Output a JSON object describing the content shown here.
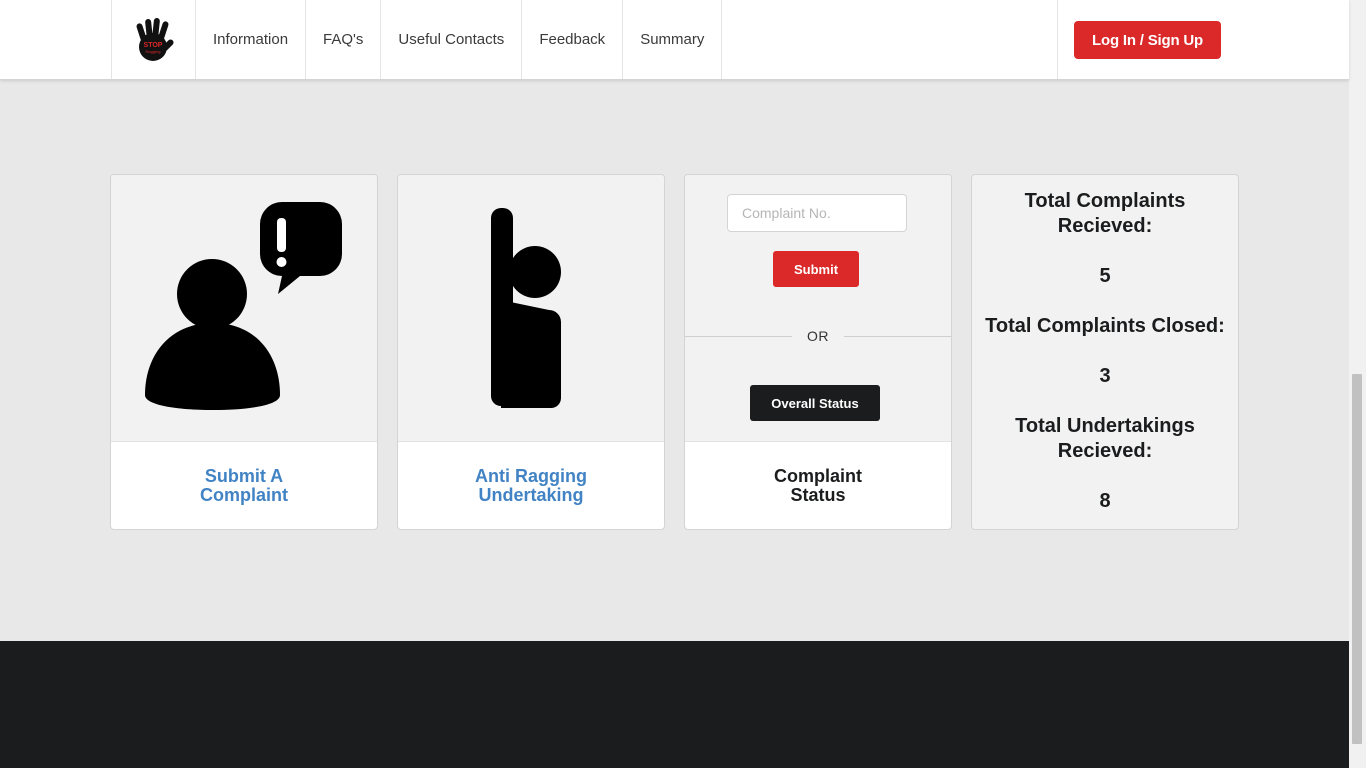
{
  "navbar": {
    "logo_text": "STOP Ragging",
    "items": [
      {
        "label": "Information"
      },
      {
        "label": "FAQ's"
      },
      {
        "label": "Useful Contacts"
      },
      {
        "label": "Feedback"
      },
      {
        "label": "Summary"
      }
    ],
    "login_label": "Log In / Sign Up"
  },
  "cards": {
    "submit_complaint": {
      "label_line1": "Submit A",
      "label_line2": "Complaint",
      "icon": "person-speech-exclamation-icon"
    },
    "anti_ragging": {
      "label_line1": "Anti Ragging",
      "label_line2": "Undertaking",
      "icon": "raised-hand-icon"
    },
    "status": {
      "input_placeholder": "Complaint No.",
      "submit_label": "Submit",
      "or_label": "OR",
      "overall_label": "Overall Status",
      "label_line1": "Complaint",
      "label_line2": "Status"
    },
    "stats": {
      "received_label": "Total Complaints Recieved:",
      "received_value": "5",
      "closed_label": "Total Complaints Closed:",
      "closed_value": "3",
      "undertakings_label": "Total Undertakings Recieved:",
      "undertakings_value": "8"
    }
  },
  "colors": {
    "accent_red": "#db2828",
    "link_blue": "#4183c4",
    "dark": "#1b1c1d"
  }
}
